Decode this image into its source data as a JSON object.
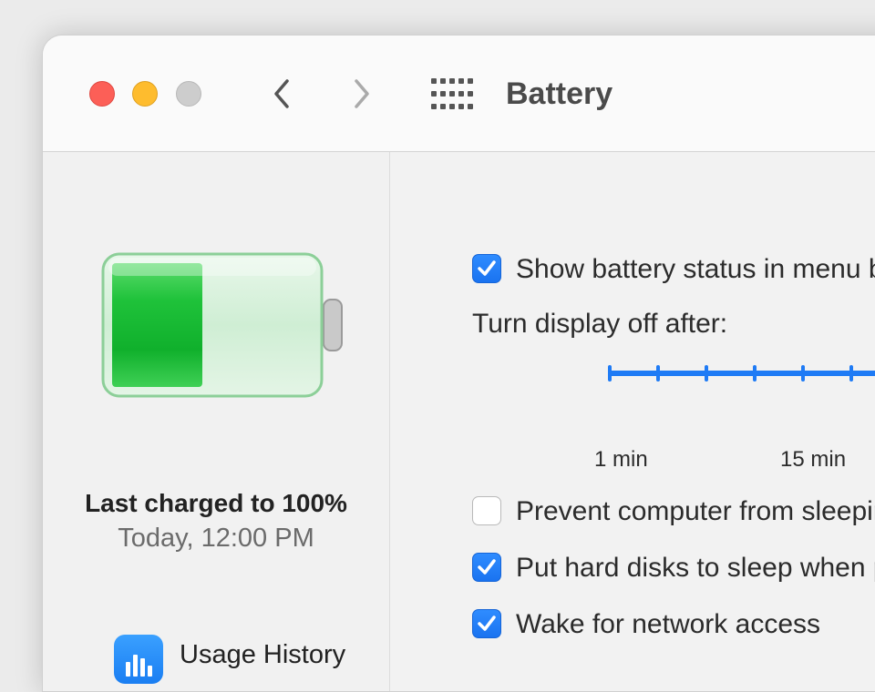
{
  "window": {
    "title": "Battery"
  },
  "titlebar": {
    "close_icon": "close-traffic-light",
    "minimize_icon": "minimize-traffic-light",
    "zoom_icon": "zoom-traffic-light-disabled",
    "back_icon": "chevron-left-icon",
    "forward_icon": "chevron-right-icon",
    "grid_icon": "show-all-grid-icon"
  },
  "sidebar": {
    "battery_level_percent": 45,
    "charged_title": "Last charged to 100%",
    "charged_time": "Today, 12:00 PM",
    "usage_history_label": "Usage History"
  },
  "settings": {
    "show_status": {
      "label": "Show battery status in menu bar",
      "checked": true
    },
    "display_off_label": "Turn display off after:",
    "slider_ticks": [
      "1 min",
      "15 min"
    ],
    "prevent_sleep": {
      "label": "Prevent computer from sleeping automatically",
      "checked": false
    },
    "hard_disks": {
      "label": "Put hard disks to sleep when possible",
      "checked": true
    },
    "wake_network": {
      "label": "Wake for network access",
      "checked": true
    }
  },
  "colors": {
    "accent": "#1f7bf5",
    "battery_green": "#1cc23c",
    "close": "#fc5f57",
    "minimize": "#febc2e"
  }
}
